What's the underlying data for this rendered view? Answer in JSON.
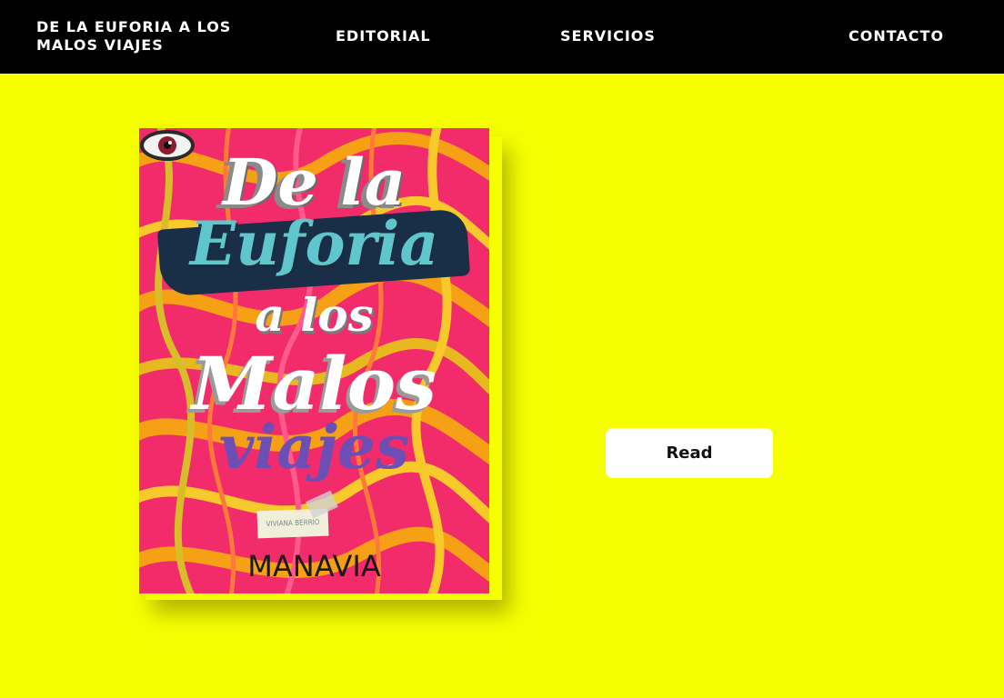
{
  "header": {
    "brand": "DE LA EUFORIA A LOS MALOS VIAJES",
    "nav": {
      "editorial": "EDITORIAL",
      "servicios": "SERVICIOS",
      "contacto": "CONTACTO"
    }
  },
  "book": {
    "title_lines": {
      "line1": "De la",
      "line2": "Euforia",
      "line3": "a los",
      "line4": "Malos",
      "line5": "viajes"
    },
    "author": "VIVIANA BERRIO",
    "publisher": "MANAVIA"
  },
  "actions": {
    "read_label": "Read"
  },
  "colors": {
    "page_background": "#f6ff00",
    "header_background": "#000000",
    "cover_pink": "#f22b6b",
    "cover_orange": "#f5a015",
    "euforia_teal": "#5fc7cc",
    "viajes_purple": "#6b4fb5"
  },
  "icons": {
    "eye_left": "eye-icon",
    "eye_right": "eye-icon"
  }
}
